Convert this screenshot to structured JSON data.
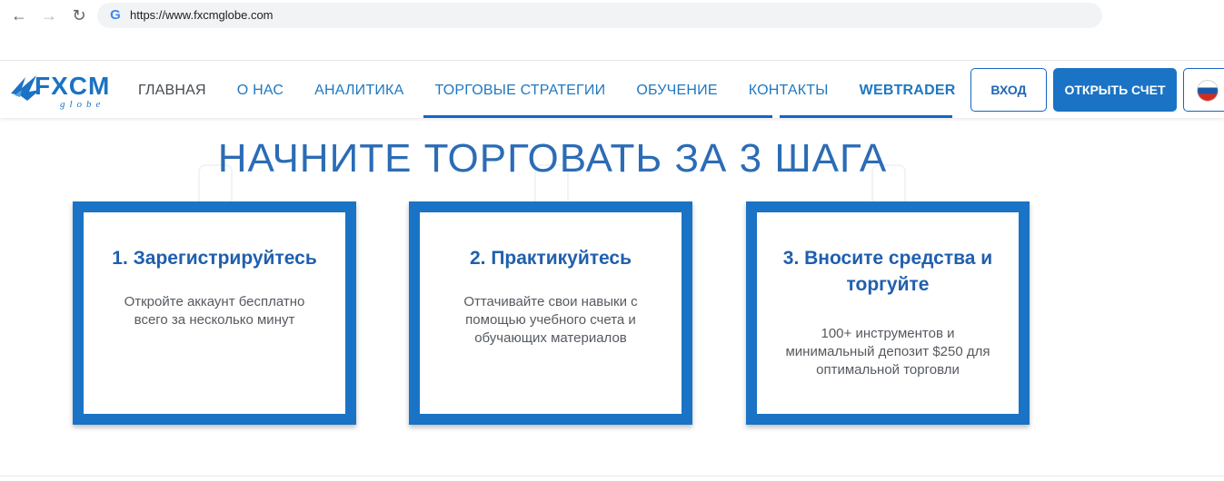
{
  "browser": {
    "url": "https://www.fxcmglobe.com"
  },
  "header": {
    "logo_main": "FXCM",
    "logo_sub": "globe",
    "menu": [
      "ГЛАВНАЯ",
      "О НАС",
      "АНАЛИТИКА",
      "ТОРГОВЫЕ СТРАТЕГИИ",
      "ОБУЧЕНИЕ",
      "КОНТАКТЫ",
      "WEBTRADER"
    ],
    "login_label": "ВХОД",
    "open_account_label": "ОТКРЫТЬ СЧЕТ",
    "language_flag": "russia-flag-icon"
  },
  "hero": {
    "title": "НАЧНИТЕ ТОРГОВАТЬ ЗА 3 ШАГА"
  },
  "cards": [
    {
      "title": "1. Зарегистрируйтесь",
      "desc": "Откройте аккаунт бесплатно всего за несколько минут"
    },
    {
      "title": "2. Практикуйтесь",
      "desc": "Оттачивайте свои навыки с помощью учебного счета и обучающих материалов"
    },
    {
      "title": "3. Вносите средства и торгуйте",
      "desc": "100+ инструментов и минимальный депозит $250 для оптимальной торговли"
    }
  ],
  "colors": {
    "brand_blue": "#1a73c4",
    "title_blue": "#2b6cb5",
    "text_gray": "#555a60"
  }
}
